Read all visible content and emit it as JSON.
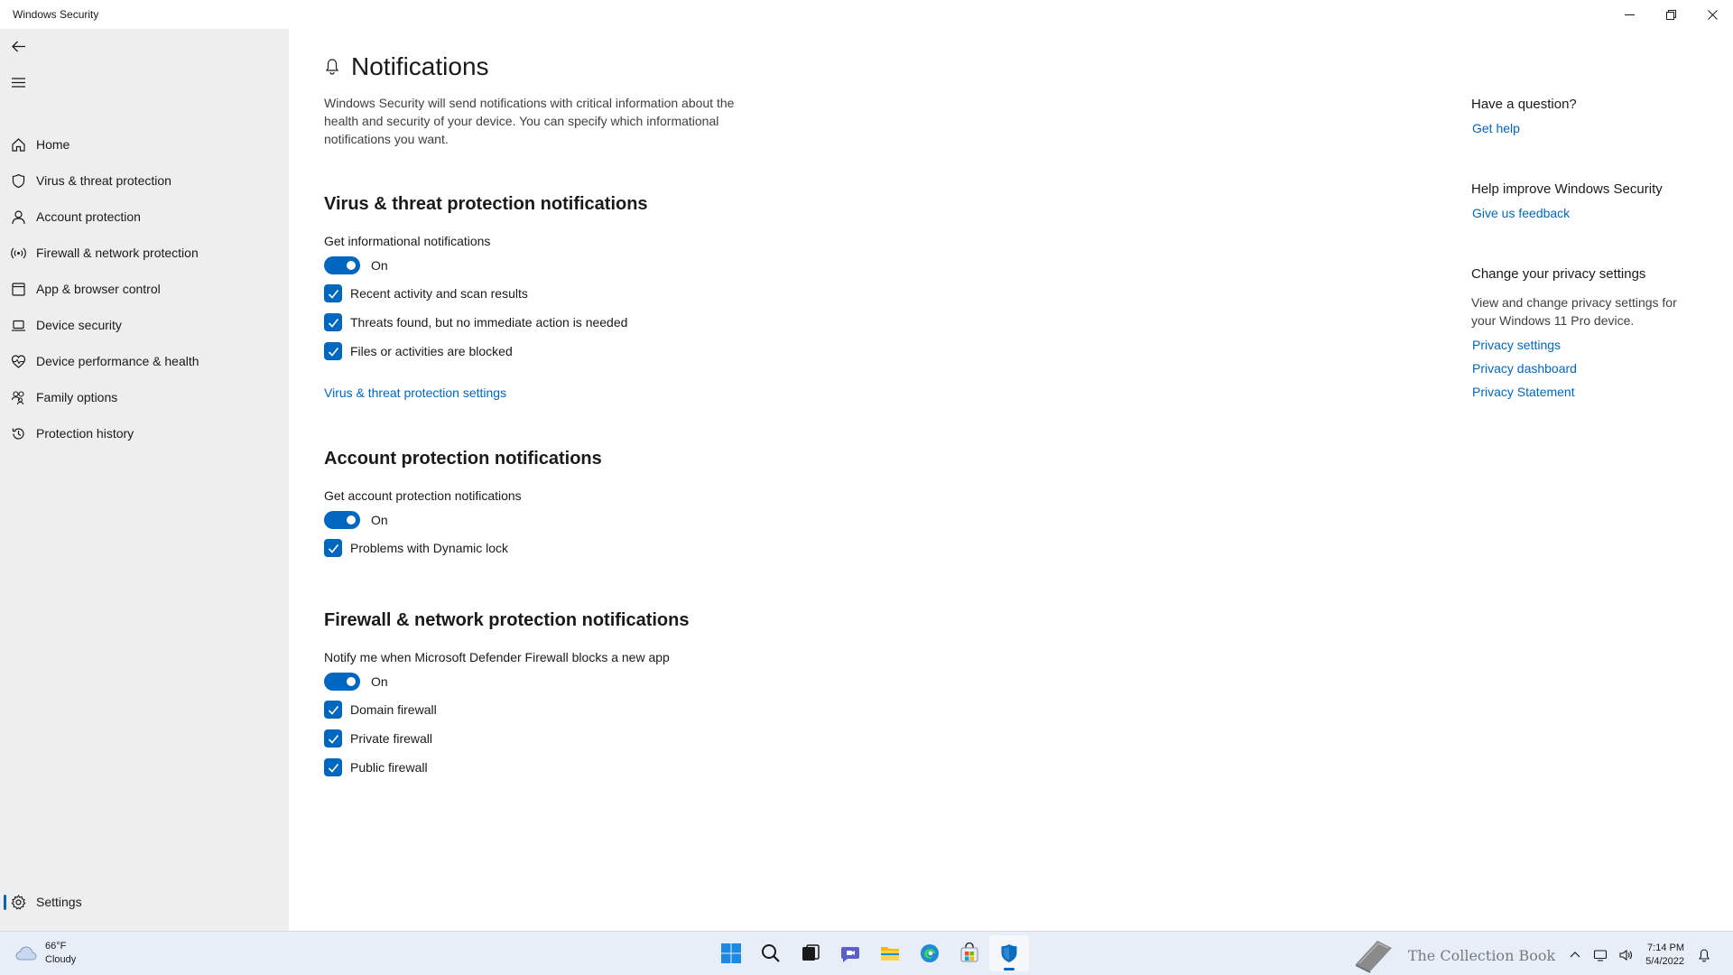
{
  "window": {
    "title": "Windows Security"
  },
  "sidebar": {
    "items": [
      {
        "label": "Home",
        "icon": "home-icon"
      },
      {
        "label": "Virus & threat protection",
        "icon": "shield-icon"
      },
      {
        "label": "Account protection",
        "icon": "person-icon"
      },
      {
        "label": "Firewall & network protection",
        "icon": "wireless-icon"
      },
      {
        "label": "App & browser control",
        "icon": "app-window-icon"
      },
      {
        "label": "Device security",
        "icon": "laptop-icon"
      },
      {
        "label": "Device performance & health",
        "icon": "heart-icon"
      },
      {
        "label": "Family options",
        "icon": "family-icon"
      },
      {
        "label": "Protection history",
        "icon": "history-icon"
      }
    ],
    "settings_label": "Settings"
  },
  "main": {
    "title": "Notifications",
    "intro": "Windows Security will send notifications with critical information about the health and security of your device. You can specify which informational notifications you want.",
    "virus": {
      "title": "Virus & threat protection notifications",
      "toggle_label": "Get informational notifications",
      "toggle_state": "On",
      "checks": [
        "Recent activity and scan results",
        "Threats found, but no immediate action is needed",
        "Files or activities are blocked"
      ],
      "link": "Virus & threat protection settings"
    },
    "account": {
      "title": "Account protection notifications",
      "toggle_label": "Get account protection notifications",
      "toggle_state": "On",
      "checks": [
        "Problems with Dynamic lock"
      ]
    },
    "firewall": {
      "title": "Firewall & network protection notifications",
      "toggle_label": "Notify me when Microsoft Defender Firewall blocks a new app",
      "toggle_state": "On",
      "checks": [
        "Domain firewall",
        "Private firewall",
        "Public firewall"
      ]
    }
  },
  "right_panel": {
    "question_title": "Have a question?",
    "get_help": "Get help",
    "improve_title": "Help improve Windows Security",
    "feedback": "Give us feedback",
    "privacy_title": "Change your privacy settings",
    "privacy_text": "View and change privacy settings for your Windows 11 Pro device.",
    "privacy_links": [
      "Privacy settings",
      "Privacy dashboard",
      "Privacy Statement"
    ]
  },
  "taskbar": {
    "weather_temp": "66°F",
    "weather_cond": "Cloudy",
    "watermark": "The Collection Book",
    "time": "7:14 PM",
    "date": "5/4/2022",
    "apps": [
      "start-icon",
      "search-icon",
      "task-view-icon",
      "chat-icon",
      "file-explorer-icon",
      "edge-icon",
      "store-icon",
      "windows-security-icon"
    ]
  },
  "colors": {
    "accent": "#0067c0",
    "sidebar_bg": "#eeeeee",
    "taskbar_bg": "#e8eef7"
  }
}
